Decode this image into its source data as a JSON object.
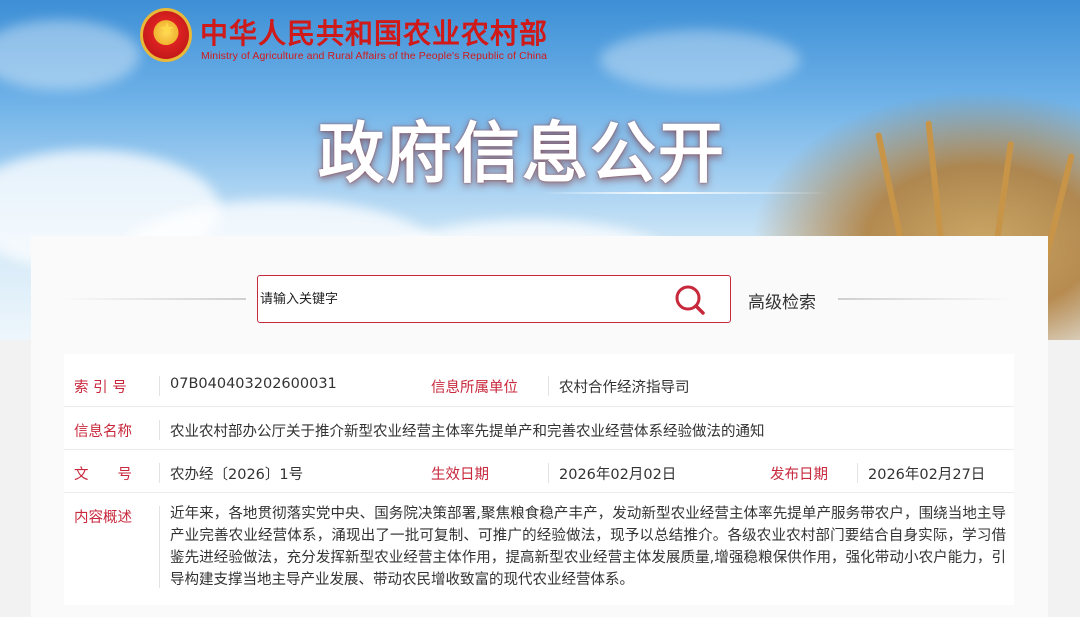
{
  "header": {
    "site_title": "中华人民共和国农业农村部",
    "site_subtitle": "Ministry of Agriculture and Rural Affairs of the People's Republic of China",
    "banner_title": "政府信息公开"
  },
  "search": {
    "placeholder": "请输入关键字",
    "advanced_label": "高级检索"
  },
  "info": {
    "index_label": "索 引 号",
    "index_value": "07B040403202600031",
    "unit_label": "信息所属单位",
    "unit_value": "农村合作经济指导司",
    "name_label": "信息名称",
    "name_value": "农业农村部办公厅关于推介新型农业经营主体率先提单产和完善农业经营体系经验做法的通知",
    "doc_label": "文　　号",
    "doc_value": "农办经〔2026〕1号",
    "effective_label": "生效日期",
    "effective_value": "2026年02月02日",
    "publish_label": "发布日期",
    "publish_value": "2026年02月27日",
    "summary_label": "内容概述",
    "summary_value": "近年来，各地贯彻落实党中央、国务院决策部署,聚焦粮食稳产丰产，发动新型农业经营主体率先提单产服务带农户，围绕当地主导产业完善农业经营体系，涌现出了一批可复制、可推广的经验做法，现予以总结推介。各级农业农村部门要结合自身实际，学习借鉴先进经验做法，充分发挥新型农业经营主体作用，提高新型农业经营主体发展质量,增强稳粮保供作用，强化带动小农户能力，引导构建支撑当地主导产业发展、带动农民增收致富的现代农业经营体系。"
  },
  "colors": {
    "accent_red": "#c8283c",
    "title_red": "#d01a1a"
  }
}
